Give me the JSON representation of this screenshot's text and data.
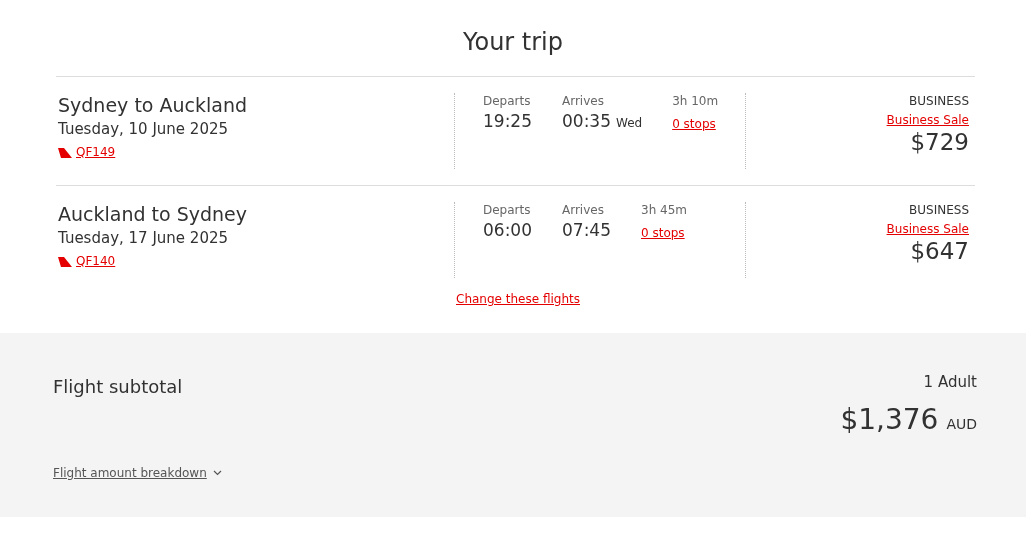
{
  "title": "Your trip",
  "flights": [
    {
      "route": "Sydney to Auckland",
      "date": "Tuesday, 10 June 2025",
      "flight_number": "QF149",
      "departs_label": "Departs",
      "departs": "19:25",
      "arrives_label": "Arrives",
      "arrives": "00:35",
      "arrives_day": "Wed",
      "duration": "3h 10m",
      "stops": "0 stops",
      "cabin": "BUSINESS",
      "fare": "Business Sale",
      "price": "$729"
    },
    {
      "route": "Auckland to Sydney",
      "date": "Tuesday, 17 June 2025",
      "flight_number": "QF140",
      "departs_label": "Departs",
      "departs": "06:00",
      "arrives_label": "Arrives",
      "arrives": "07:45",
      "duration": "3h 45m",
      "stops": "0 stops",
      "cabin": "BUSINESS",
      "fare": "Business Sale",
      "price": "$647"
    }
  ],
  "change_link": "Change these flights",
  "subtotal": {
    "label": "Flight subtotal",
    "passengers": "1 Adult",
    "amount": "$1,376",
    "currency": "AUD",
    "breakdown_link": "Flight amount breakdown",
    "breakdown_expanded": false
  }
}
